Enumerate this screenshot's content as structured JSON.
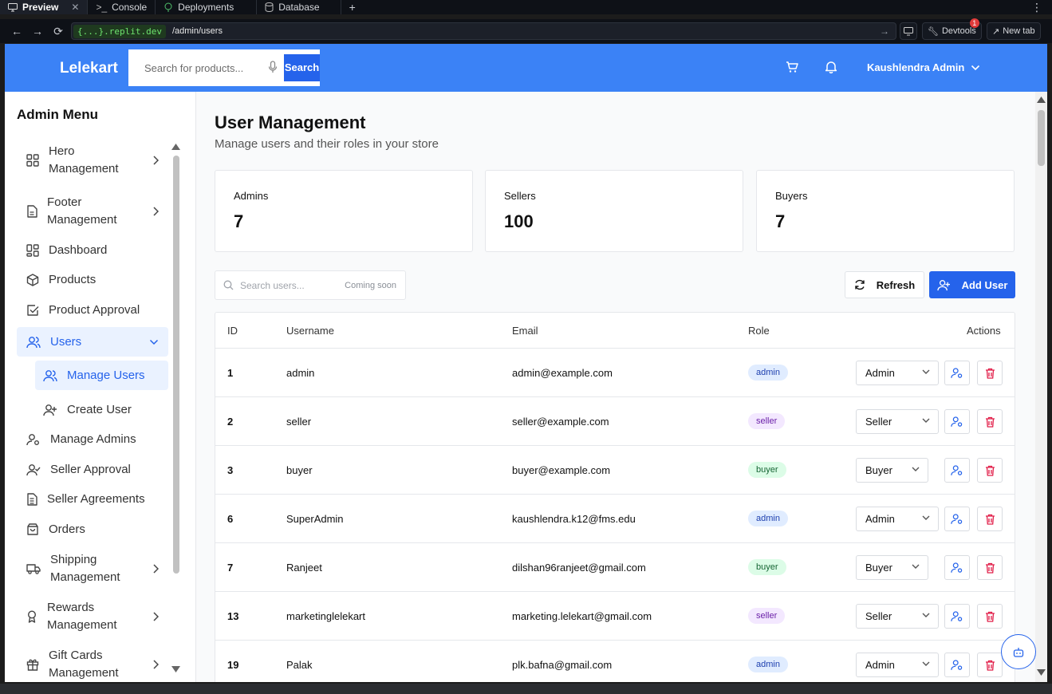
{
  "browser": {
    "tabs": [
      {
        "label": "Preview",
        "active": true
      },
      {
        "label": "Console",
        "active": false
      },
      {
        "label": "Deployments",
        "active": false
      },
      {
        "label": "Database",
        "active": false
      }
    ],
    "domain": "{...}.replit.dev",
    "path": "/admin/users",
    "devtools_label": "Devtools",
    "devtools_badge": "1",
    "newtab_label": "New tab"
  },
  "header": {
    "logo": "Lelekart",
    "search_placeholder": "Search for products...",
    "search_button": "Search",
    "user_name": "Kaushlendra Admin",
    "brand_color": "#3b82f6"
  },
  "sidebar": {
    "title": "Admin Menu",
    "items": [
      {
        "label": "Hero Management",
        "icon": "grid-icon",
        "chevron": true
      },
      {
        "label": "Footer Management",
        "icon": "file-icon",
        "chevron": true
      },
      {
        "label": "Dashboard",
        "icon": "dashboard-icon"
      },
      {
        "label": "Products",
        "icon": "box-icon"
      },
      {
        "label": "Product Approval",
        "icon": "check-square-icon"
      },
      {
        "label": "Users",
        "icon": "users-icon",
        "active": true,
        "expanded": true
      },
      {
        "label": "Manage Users",
        "icon": "users-icon",
        "sub": true,
        "active": true
      },
      {
        "label": "Create User",
        "icon": "user-plus-icon",
        "sub": true
      },
      {
        "label": "Manage Admins",
        "icon": "user-cog-icon"
      },
      {
        "label": "Seller Approval",
        "icon": "user-check-icon"
      },
      {
        "label": "Seller Agreements",
        "icon": "document-icon"
      },
      {
        "label": "Orders",
        "icon": "bag-icon"
      },
      {
        "label": "Shipping Management",
        "icon": "truck-icon",
        "chevron": true
      },
      {
        "label": "Rewards Management",
        "icon": "award-icon",
        "chevron": true
      },
      {
        "label": "Gift Cards Management",
        "icon": "gift-icon",
        "chevron": true
      }
    ]
  },
  "main": {
    "title": "User Management",
    "subtitle": "Manage users and their roles in your store",
    "stats": [
      {
        "label": "Admins",
        "value": "7"
      },
      {
        "label": "Sellers",
        "value": "100"
      },
      {
        "label": "Buyers",
        "value": "7"
      }
    ],
    "search_placeholder": "Search users...",
    "coming_soon": "Coming soon",
    "refresh_label": "Refresh",
    "add_user_label": "Add User",
    "table": {
      "headers": [
        "ID",
        "Username",
        "Email",
        "Role",
        "Actions"
      ],
      "rows": [
        {
          "id": "1",
          "username": "admin",
          "email": "admin@example.com",
          "role": "admin",
          "select": "Admin"
        },
        {
          "id": "2",
          "username": "seller",
          "email": "seller@example.com",
          "role": "seller",
          "select": "Seller"
        },
        {
          "id": "3",
          "username": "buyer",
          "email": "buyer@example.com",
          "role": "buyer",
          "select": "Buyer"
        },
        {
          "id": "6",
          "username": "SuperAdmin",
          "email": "kaushlendra.k12@fms.edu",
          "role": "admin",
          "select": "Admin"
        },
        {
          "id": "7",
          "username": "Ranjeet",
          "email": "dilshan96ranjeet@gmail.com",
          "role": "buyer",
          "select": "Buyer"
        },
        {
          "id": "13",
          "username": "marketinglelekart",
          "email": "marketing.lelekart@gmail.com",
          "role": "seller",
          "select": "Seller"
        },
        {
          "id": "19",
          "username": "Palak",
          "email": "plk.bafna@gmail.com",
          "role": "admin",
          "select": "Admin"
        }
      ]
    }
  }
}
